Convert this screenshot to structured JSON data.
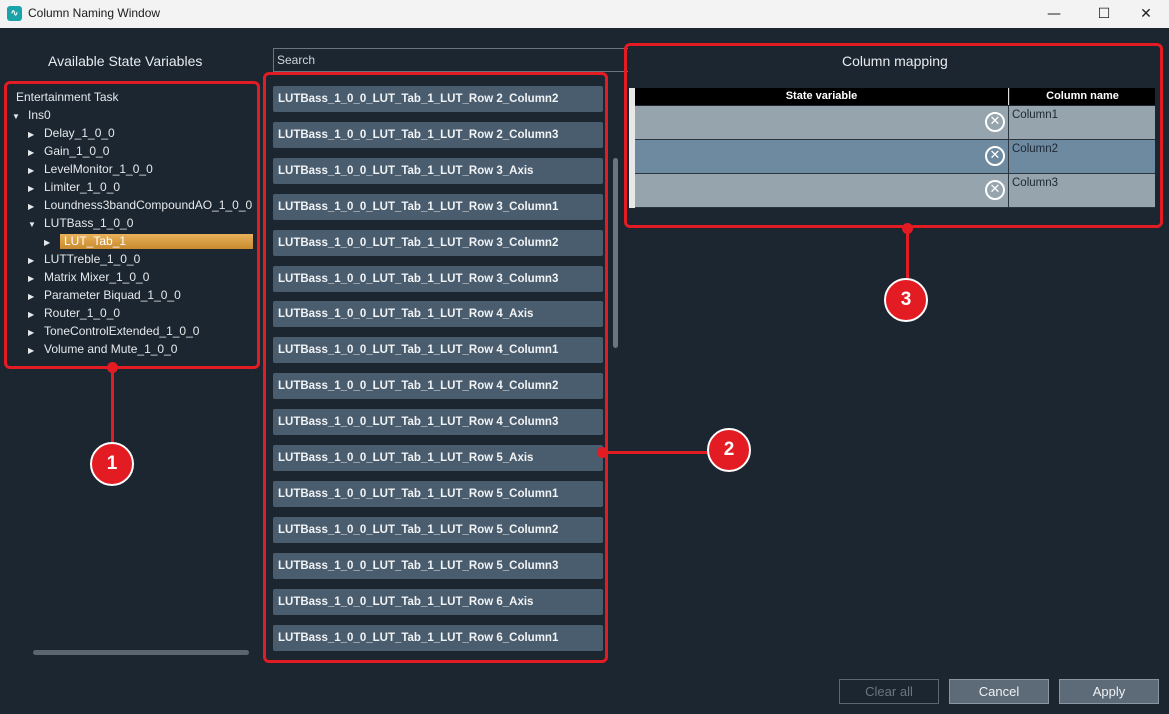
{
  "window": {
    "title": "Column Naming Window",
    "controls": {
      "minimize": "—",
      "maximize": "☐",
      "close": "✕"
    }
  },
  "left_panel": {
    "title": "Available State Variables",
    "tree": [
      {
        "label": "Entertainment Task",
        "level": 0,
        "arrow": ""
      },
      {
        "label": "Ins0",
        "level": 0,
        "arrow": "▼"
      },
      {
        "label": "Delay_1_0_0",
        "level": 1,
        "arrow": "▶"
      },
      {
        "label": "Gain_1_0_0",
        "level": 1,
        "arrow": "▶"
      },
      {
        "label": "LevelMonitor_1_0_0",
        "level": 1,
        "arrow": "▶"
      },
      {
        "label": "Limiter_1_0_0",
        "level": 1,
        "arrow": "▶"
      },
      {
        "label": "Loundness3bandCompoundAO_1_0_0",
        "level": 1,
        "arrow": "▶"
      },
      {
        "label": "LUTBass_1_0_0",
        "level": 1,
        "arrow": "▼"
      },
      {
        "label": "LUT_Tab_1",
        "level": 2,
        "arrow": "▶",
        "selected": true
      },
      {
        "label": "LUTTreble_1_0_0",
        "level": 1,
        "arrow": "▶"
      },
      {
        "label": "Matrix Mixer_1_0_0",
        "level": 1,
        "arrow": "▶"
      },
      {
        "label": "Parameter Biquad_1_0_0",
        "level": 1,
        "arrow": "▶"
      },
      {
        "label": "Router_1_0_0",
        "level": 1,
        "arrow": "▶"
      },
      {
        "label": "ToneControlExtended_1_0_0",
        "level": 1,
        "arrow": "▶"
      },
      {
        "label": "Volume and Mute_1_0_0",
        "level": 1,
        "arrow": "▶"
      }
    ]
  },
  "search": {
    "placeholder": "Search"
  },
  "variables": [
    "LUTBass_1_0_0_LUT_Tab_1_LUT_Row 2_Column2",
    "LUTBass_1_0_0_LUT_Tab_1_LUT_Row 2_Column3",
    "LUTBass_1_0_0_LUT_Tab_1_LUT_Row 3_Axis",
    "LUTBass_1_0_0_LUT_Tab_1_LUT_Row 3_Column1",
    "LUTBass_1_0_0_LUT_Tab_1_LUT_Row 3_Column2",
    "LUTBass_1_0_0_LUT_Tab_1_LUT_Row 3_Column3",
    "LUTBass_1_0_0_LUT_Tab_1_LUT_Row 4_Axis",
    "LUTBass_1_0_0_LUT_Tab_1_LUT_Row 4_Column1",
    "LUTBass_1_0_0_LUT_Tab_1_LUT_Row 4_Column2",
    "LUTBass_1_0_0_LUT_Tab_1_LUT_Row 4_Column3",
    "LUTBass_1_0_0_LUT_Tab_1_LUT_Row 5_Axis",
    "LUTBass_1_0_0_LUT_Tab_1_LUT_Row 5_Column1",
    "LUTBass_1_0_0_LUT_Tab_1_LUT_Row 5_Column2",
    "LUTBass_1_0_0_LUT_Tab_1_LUT_Row 5_Column3",
    "LUTBass_1_0_0_LUT_Tab_1_LUT_Row 6_Axis",
    "LUTBass_1_0_0_LUT_Tab_1_LUT_Row 6_Column1"
  ],
  "mapping": {
    "title": "Column mapping",
    "headers": {
      "state_variable": "State variable",
      "column_name": "Column name"
    },
    "rows": [
      {
        "column_name": "Column1",
        "bg": "#96a4ae"
      },
      {
        "column_name": "Column2",
        "bg": "#6e8aa1"
      },
      {
        "column_name": "Column3",
        "bg": "#96a4ae"
      }
    ],
    "remove_glyph": "✕"
  },
  "annotations": {
    "badge1": "1",
    "badge2": "2",
    "badge3": "3"
  },
  "buttons": {
    "clear_all": "Clear all",
    "cancel": "Cancel",
    "apply": "Apply"
  },
  "colors": {
    "accent_red": "#e31b23",
    "selected_gold": "#d89c3f",
    "item_bg": "#4a5d6e",
    "window_bg": "#1b2631"
  }
}
